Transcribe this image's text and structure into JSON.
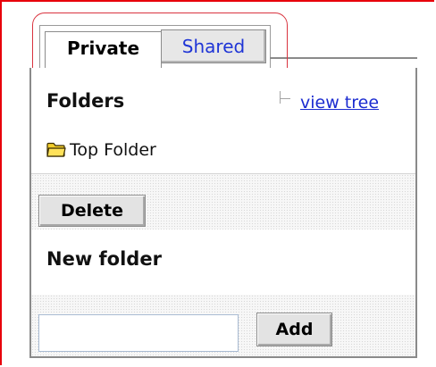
{
  "tabs": {
    "private_label": "Private",
    "shared_label": "Shared"
  },
  "folders": {
    "title": "Folders",
    "view_tree_label": "view tree",
    "items": [
      {
        "label": "Top Folder",
        "icon": "folder-icon"
      }
    ]
  },
  "actions": {
    "delete_label": "Delete"
  },
  "new_folder": {
    "title": "New folder",
    "input_value": "",
    "add_label": "Add"
  },
  "colors": {
    "outer_frame": "#e8000b",
    "highlight_ring": "#d9343f",
    "link": "#1b2bd0",
    "folder_icon": "#f2cd2b"
  }
}
